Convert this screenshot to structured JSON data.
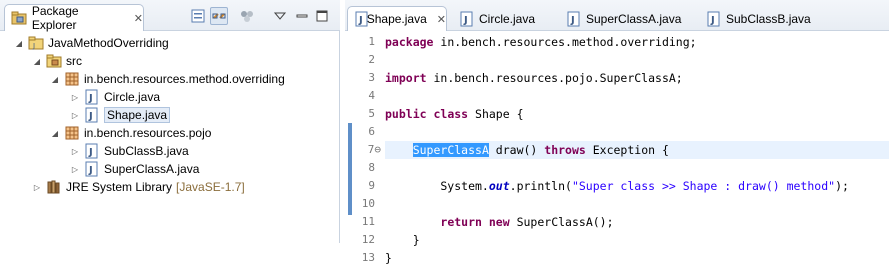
{
  "explorer": {
    "tab_label": "Package Explorer",
    "close_glyph": "✕",
    "tree": [
      {
        "label": "JavaMethodOverriding",
        "icon": "project-icon",
        "twisty": "▲",
        "level": 0
      },
      {
        "label": "src",
        "icon": "source-folder-icon",
        "twisty": "▲",
        "level": 1
      },
      {
        "label": "in.bench.resources.method.overriding",
        "icon": "package-icon",
        "twisty": "▲",
        "level": 2
      },
      {
        "label": "Circle.java",
        "icon": "java-file-icon",
        "twisty": "▷",
        "level": 3
      },
      {
        "label": "Shape.java",
        "icon": "java-file-icon",
        "twisty": "▷",
        "level": 3,
        "selected": true
      },
      {
        "label": "in.bench.resources.pojo",
        "icon": "package-icon",
        "twisty": "▲",
        "level": 2
      },
      {
        "label": "SubClassB.java",
        "icon": "java-file-icon",
        "twisty": "▷",
        "level": 3
      },
      {
        "label": "SuperClassA.java",
        "icon": "java-file-icon",
        "twisty": "▷",
        "level": 3
      },
      {
        "label": "JRE System Library",
        "extra": "[JavaSE-1.7]",
        "icon": "library-icon",
        "twisty": "▷",
        "level": 1
      }
    ]
  },
  "editor": {
    "tabs": [
      {
        "label": "Shape.java",
        "active": true,
        "close": "✕"
      },
      {
        "label": "Circle.java",
        "active": false
      },
      {
        "label": "SuperClassA.java",
        "active": false
      },
      {
        "label": "SubClassB.java",
        "active": false
      }
    ],
    "line_numbers": [
      "1",
      "2",
      "3",
      "4",
      "5",
      "6",
      "7⊖",
      "8",
      "9",
      "10",
      "11",
      "12",
      "13"
    ],
    "code": {
      "l1_kw": "package",
      "l1_rest": " in.bench.resources.method.overriding;",
      "l3_kw": "import",
      "l3_rest": " in.bench.resources.pojo.SuperClassA;",
      "l5_kw1": "public",
      "l5_kw2": "class",
      "l5_rest": " Shape {",
      "l7_indent": "    ",
      "l7_type": "SuperClassA",
      "l7_mid": " draw() ",
      "l7_kw": "throws",
      "l7_rest": " Exception {",
      "l9_pre": "        System.",
      "l9_field": "out",
      "l9_mid": ".println(",
      "l9_str": "\"Super class >> Shape : draw() method\"",
      "l9_end": ");",
      "l11_indent": "        ",
      "l11_kw1": "return",
      "l11_kw2": "new",
      "l11_rest": " SuperClassA();",
      "l12": "    }",
      "l13": "}"
    }
  },
  "colors": {
    "keyword": "#7f0055",
    "string": "#2a00ff",
    "field": "#0000c0",
    "selection": "#3399ff",
    "current_line": "#e8f2fe"
  }
}
